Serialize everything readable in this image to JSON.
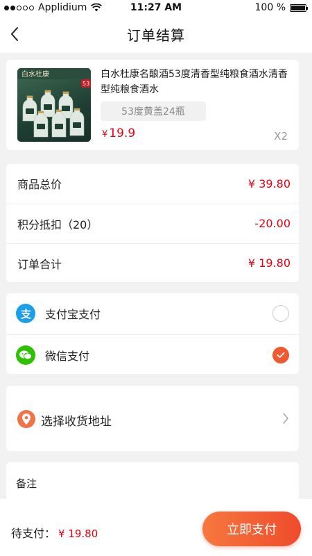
{
  "status_bar": {
    "carrier": "Applidium",
    "time": "11:27 AM",
    "battery": "100 %"
  },
  "nav": {
    "title": "订单结算"
  },
  "product": {
    "name": "白水杜康名酿酒53度清香型纯粮食酒水清香型纯粮食酒水",
    "spec": "53度黄盖24瓶",
    "currency": "¥",
    "price": "19.9",
    "quantity": "X2",
    "image_badge": "白水杜康",
    "image_tag": "53"
  },
  "summary": {
    "rows": [
      {
        "label": "商品总价",
        "value": "¥ 39.80"
      },
      {
        "label": "积分抵扣（20）",
        "value": "-20.00"
      },
      {
        "label": "订单合计",
        "value": "¥ 19.80"
      }
    ]
  },
  "payment": {
    "options": [
      {
        "label": "支付宝支付",
        "icon": "alipay-icon",
        "color": "#1aa0e8",
        "selected": false
      },
      {
        "label": "微信支付",
        "icon": "wechat-icon",
        "color": "#2dc100",
        "selected": true
      }
    ],
    "accent": "#ef5a33"
  },
  "address": {
    "label": "选择收货地址"
  },
  "note": {
    "label": "备注"
  },
  "footer": {
    "due_label": "待支付：",
    "due_amount": "¥ 19.80",
    "pay_button": "立即支付"
  }
}
